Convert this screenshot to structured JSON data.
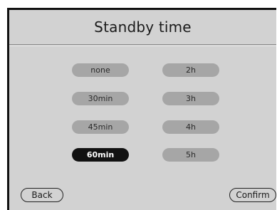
{
  "title": "Standby time",
  "options": {
    "left": [
      "none",
      "30min",
      "45min",
      "60min"
    ],
    "right": [
      "2h",
      "3h",
      "4h",
      "5h"
    ]
  },
  "selected": "60min",
  "buttons": {
    "back": "Back",
    "confirm": "Confirm"
  },
  "colors": {
    "screen_background": "#d2d2d2",
    "option_background": "#a6a6a6",
    "selected_background": "#111111",
    "selected_text": "#ffffff"
  }
}
